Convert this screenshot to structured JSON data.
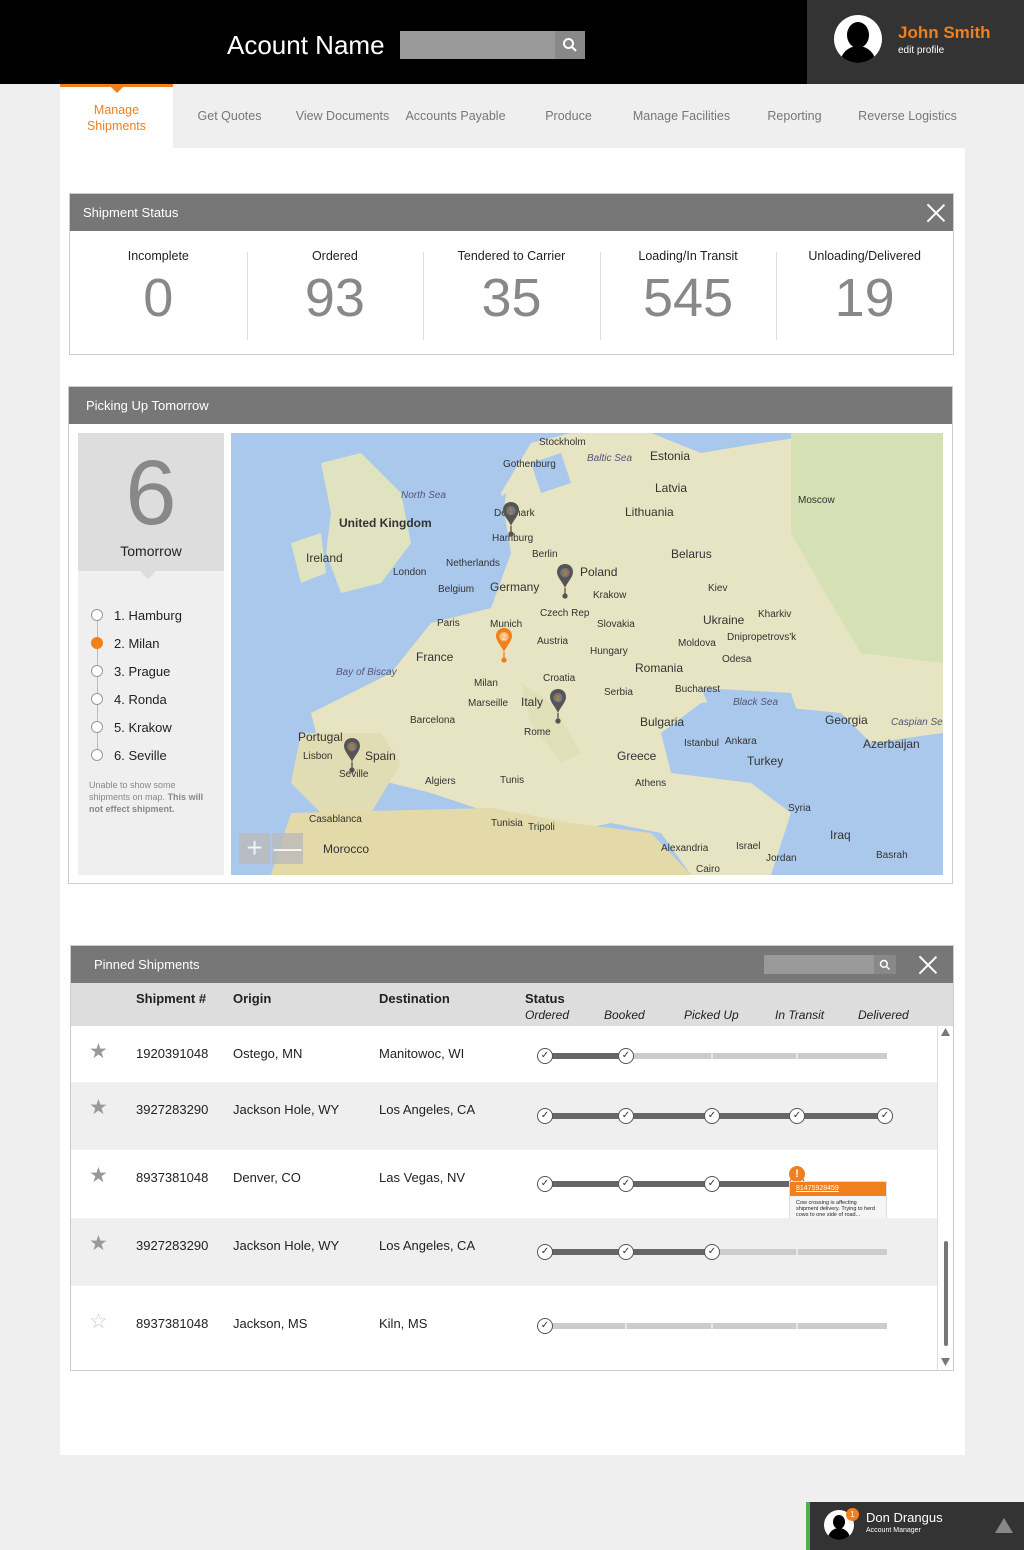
{
  "header": {
    "account_name": "Acount Name",
    "search_placeholder": ""
  },
  "profile": {
    "name": "John Smith",
    "edit_label": "edit profile"
  },
  "nav": {
    "items": [
      {
        "label": "Manage Shipments",
        "active": true
      },
      {
        "label": "Get Quotes"
      },
      {
        "label": "View Documents"
      },
      {
        "label": "Accounts Payable"
      },
      {
        "label": "Produce"
      },
      {
        "label": "Manage Facilities"
      },
      {
        "label": "Reporting"
      },
      {
        "label": "Reverse Logistics"
      }
    ]
  },
  "shipment_status": {
    "title": "Shipment Status",
    "stats": [
      {
        "label": "Incomplete",
        "value": "0"
      },
      {
        "label": "Ordered",
        "value": "93"
      },
      {
        "label": "Tendered to Carrier",
        "value": "35"
      },
      {
        "label": "Loading/In Transit",
        "value": "545"
      },
      {
        "label": "Unloading/Delivered",
        "value": "19"
      }
    ]
  },
  "pickup": {
    "title": "Picking Up Tomorrow",
    "count": "6",
    "count_label": "Tomorrow",
    "locations": [
      {
        "label": "1. Hamburg",
        "selected": false
      },
      {
        "label": "2. Milan",
        "selected": true
      },
      {
        "label": "3. Prague",
        "selected": false
      },
      {
        "label": "4. Ronda",
        "selected": false
      },
      {
        "label": "5. Krakow",
        "selected": false
      },
      {
        "label": "6. Seville",
        "selected": false
      }
    ],
    "note_plain": "Unable to show some shipments on map.",
    "note_bold": "This will not effect shipment.",
    "map_labels": [
      "Stockholm",
      "Baltic Sea",
      "Estonia",
      "Gothenburg",
      "Latvia",
      "North Sea",
      "United Kingdom",
      "Denmark",
      "Lithuania",
      "Moscow",
      "Ireland",
      "Hamburg",
      "Berlin",
      "Belarus",
      "London",
      "Netherlands",
      "Poland",
      "Belgium",
      "Germany",
      "Kiev",
      "Krakow",
      "Kharkiv",
      "Czech Rep",
      "Slovakia",
      "Ukraine",
      "Paris",
      "Munich",
      "Austria",
      "Dnipropetrovs'k",
      "Moldova",
      "Hungary",
      "Odesa",
      "France",
      "Croatia",
      "Romania",
      "Bay of Biscay",
      "Milan",
      "Serbia",
      "Bucharest",
      "Black Sea",
      "Marseille",
      "Italy",
      "Bulgaria",
      "Georgia",
      "Caspian Sea",
      "Barcelona",
      "Rome",
      "Istanbul",
      "Ankara",
      "Azerbaijan",
      "Portugal",
      "Spain",
      "Greece",
      "Turkey",
      "Lisbon",
      "Seville",
      "Athens",
      "Algiers",
      "Tunis",
      "Syria",
      "Casablanca",
      "Tunisia",
      "Tripoli",
      "Iraq",
      "Israel",
      "Alexandria",
      "Jordan",
      "Morocco",
      "Basrah",
      "Cairo"
    ],
    "pins": [
      "1",
      "2",
      "3",
      "4",
      "5"
    ],
    "zoom_in": "+",
    "zoom_out": "—"
  },
  "pinned": {
    "title": "Pinned Shipments",
    "columns": {
      "shipment": "Shipment #",
      "origin": "Origin",
      "destination": "Destination",
      "status": "Status"
    },
    "stages": [
      "Ordered",
      "Booked",
      "Picked Up",
      "In Transit",
      "Delivered"
    ],
    "rows": [
      {
        "starred": true,
        "shipment": "1920391048",
        "origin": "Ostego, MN",
        "destination": "Manitowoc, WI",
        "progress": 1
      },
      {
        "starred": true,
        "shipment": "3927283290",
        "origin": "Jackson Hole, WY",
        "destination": "Los Angeles, CA",
        "progress": 4
      },
      {
        "starred": true,
        "shipment": "8937381048",
        "origin": "Denver, CO",
        "destination": "Las Vegas, NV",
        "progress": 3,
        "alert": true
      },
      {
        "starred": true,
        "shipment": "3927283290",
        "origin": "Jackson Hole, WY",
        "destination": "Los Angeles, CA",
        "progress": 2
      },
      {
        "starred": false,
        "shipment": "8937381048",
        "origin": "Jackson, MS",
        "destination": "Kiln, MS",
        "progress": 0
      }
    ],
    "alert": {
      "id": "81475928459",
      "message": "Cow crossing is affecting shipment delivery. Trying to herd cows to one side of road..."
    }
  },
  "manager": {
    "name": "Don Drangus",
    "role": "Account Manager",
    "badge": "1"
  },
  "colors": {
    "accent": "#f07f1e",
    "header": "#000000",
    "panel_head": "#777777",
    "progress_done": "#666666",
    "progress_todo": "#cccccc"
  }
}
